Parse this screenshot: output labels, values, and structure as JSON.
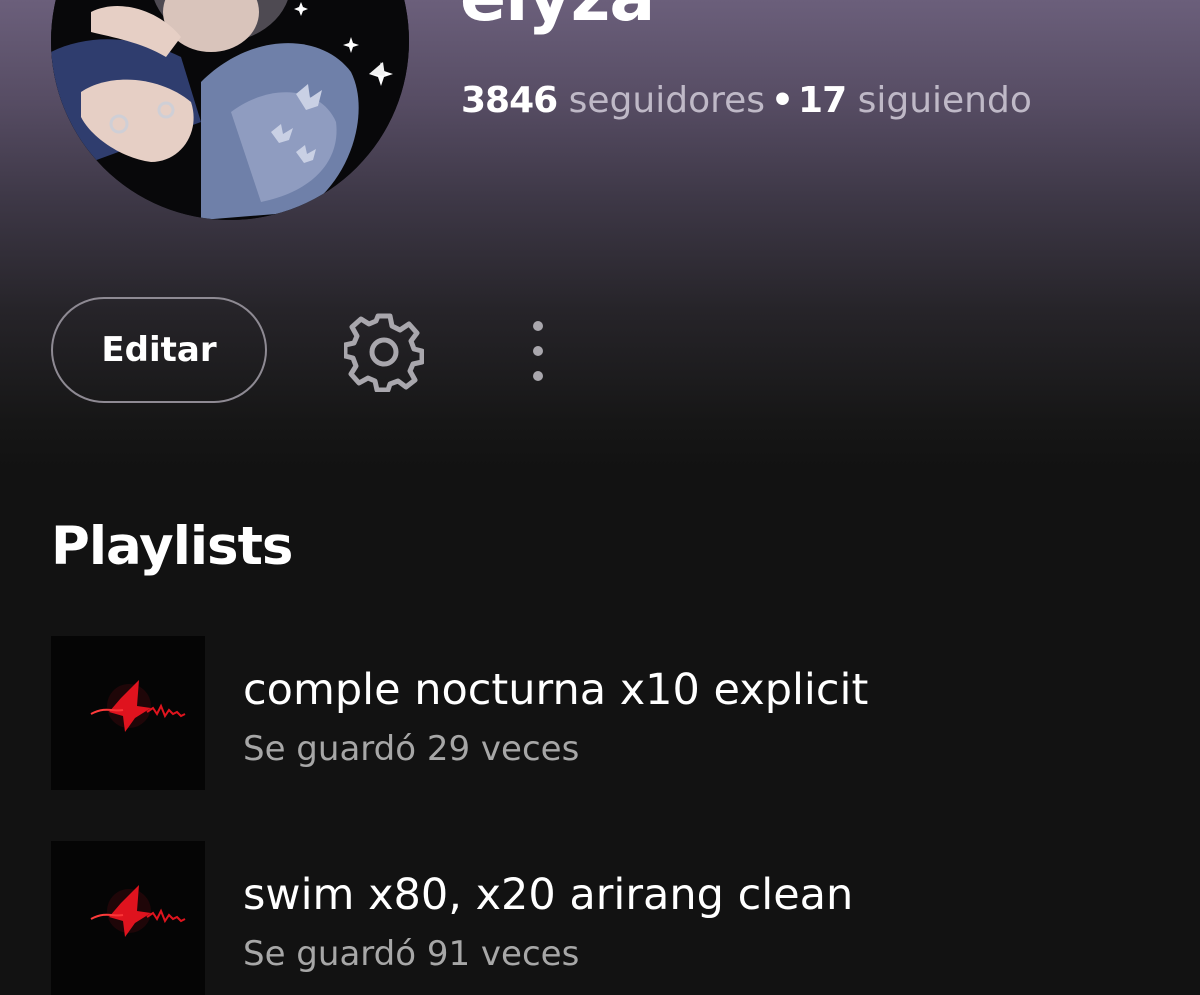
{
  "profile": {
    "username": "elyza",
    "followers_count": "3846",
    "followers_label": "seguidores",
    "separator": "•",
    "following_count": "17",
    "following_label": "siguiendo"
  },
  "actions": {
    "edit_label": "Editar",
    "settings_icon": "gear-icon",
    "more_icon": "more-vertical-icon"
  },
  "playlists_section": {
    "title": "Playlists",
    "items": [
      {
        "title": "comple nocturna x10 explicit",
        "subtitle": "Se guardó 29 veces"
      },
      {
        "title": "swim x80, x20 arirang clean",
        "subtitle": "Se guardó 91 veces"
      }
    ]
  },
  "colors": {
    "background": "#121212",
    "header_gradient_top": "#6b5f7b",
    "secondary_text": "#a7a7a7",
    "accent_red": "#e0141e"
  }
}
